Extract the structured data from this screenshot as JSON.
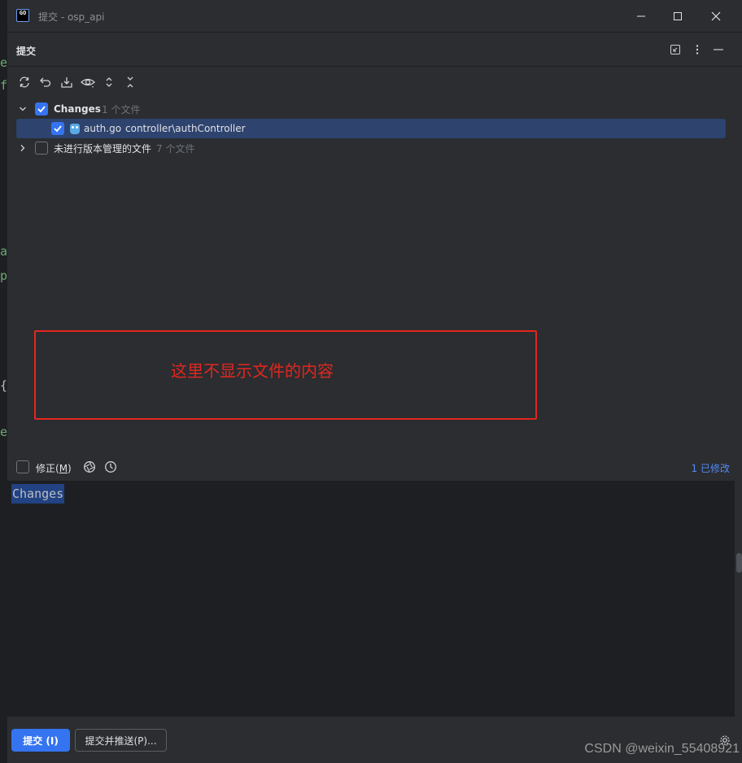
{
  "window": {
    "title": "提交 - osp_api",
    "app_icon_text": "GO"
  },
  "panel": {
    "title": "提交"
  },
  "toolbar": {
    "icons": [
      "refresh-icon",
      "rollback-icon",
      "shelve-icon",
      "preview-diff-icon",
      "expand-all-icon",
      "collapse-all-icon"
    ]
  },
  "tree": {
    "changes": {
      "label": "Changes",
      "count": "1 个文件",
      "checked": true,
      "expanded": true
    },
    "file": {
      "name": "auth.go",
      "path": "controller\\authController",
      "checked": true
    },
    "unversioned": {
      "label": "未进行版本管理的文件",
      "count": "7 个文件",
      "checked": false,
      "expanded": false
    }
  },
  "annotation": {
    "text": "这里不显示文件的内容",
    "color": "#e3261f"
  },
  "commit_options": {
    "amend_label_pre": "修正(",
    "amend_mnemonic": "M",
    "amend_label_post": ")",
    "modified_link": "1 已修改"
  },
  "message": {
    "text": "Changes"
  },
  "footer": {
    "commit_label": "提交 (I)",
    "commit_push_label": "提交并推送(P)..."
  },
  "watermark": "CSDN @weixin_55408921",
  "colors": {
    "accent": "#3574f0",
    "selection": "#2e436e",
    "link": "#548af7"
  }
}
